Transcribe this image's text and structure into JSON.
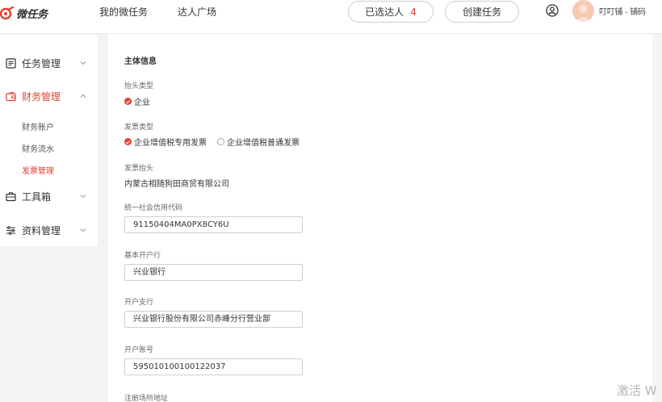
{
  "header": {
    "logo_text": "微任务",
    "nav": [
      "我的微任务",
      "达人广场"
    ],
    "selected_talent_label": "已选达人",
    "selected_talent_count": "4",
    "create_task_label": "创建任务",
    "username": "叮叮铺 - 铺码"
  },
  "sidebar": {
    "items": [
      {
        "label": "任务管理",
        "icon": "list-icon"
      },
      {
        "label": "财务管理",
        "icon": "wallet-icon"
      },
      {
        "label": "工具箱",
        "icon": "toolbox-icon"
      },
      {
        "label": "资料管理",
        "icon": "sliders-icon"
      }
    ],
    "finance_sub": [
      "财务账户",
      "财务流水",
      "发票管理"
    ]
  },
  "form": {
    "section_title": "主体信息",
    "header_type_label": "抬头类型",
    "header_type_option": "企业",
    "invoice_type_label": "发票类型",
    "invoice_type_options": [
      "企业增值税专用发票",
      "企业增值税普通发票"
    ],
    "invoice_title_label": "发票抬头",
    "invoice_title_value": "内蒙古相随狗田商贸有限公司",
    "credit_code_label": "统一社会信用代码",
    "credit_code_value": "91150404MA0PX8CY6U",
    "bank_label": "基本开户行",
    "bank_value": "兴业银行",
    "branch_label": "开户支行",
    "branch_value": "兴业银行股份有限公司赤峰分行营业部",
    "account_label": "开户账号",
    "account_value": "595010100100122037",
    "address_label": "注册场所地址"
  },
  "watermark": "激活 W",
  "colors": {
    "accent": "#e0412f"
  }
}
